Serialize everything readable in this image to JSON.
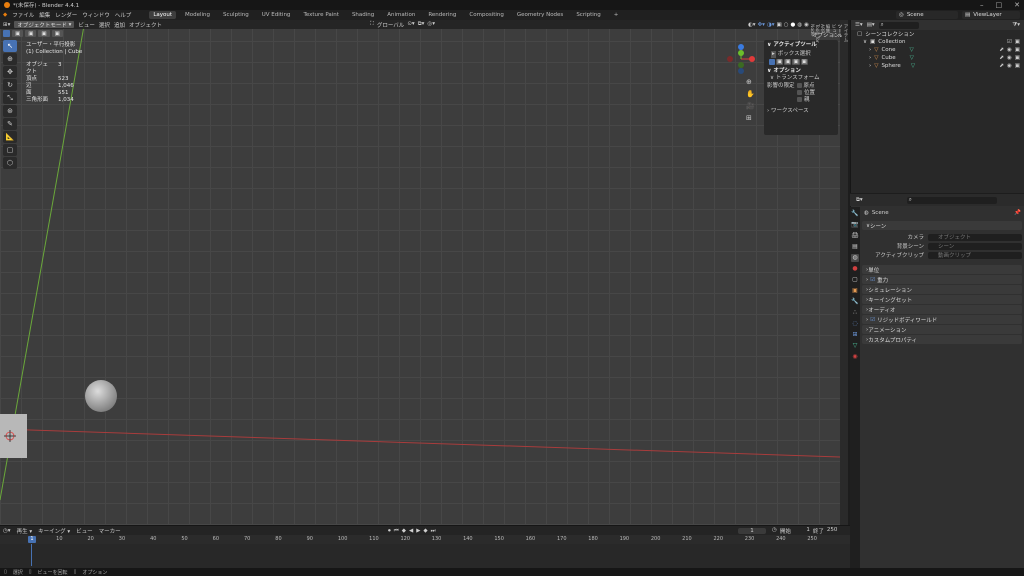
{
  "title_bar": {
    "title": "*(未保存) - Blender 4.4.1"
  },
  "menu": [
    "ファイル",
    "編集",
    "レンダー",
    "ウィンドウ",
    "ヘルプ"
  ],
  "workspaces": [
    "Layout",
    "Modeling",
    "Sculpting",
    "UV Editing",
    "Texture Paint",
    "Shading",
    "Animation",
    "Rendering",
    "Compositing",
    "Geometry Nodes",
    "Scripting"
  ],
  "workspace_add": "+",
  "scene": {
    "name": "Scene",
    "view_layer": "ViewLayer"
  },
  "viewport_header": {
    "mode": "オブジェクトモード",
    "menus": [
      "ビュー",
      "選択",
      "追加",
      "オブジェクト"
    ],
    "orientation": "グローバル",
    "options": "オプション"
  },
  "stats": {
    "view": "ユーザー・平行投影",
    "context": "(1) Collection | Cube",
    "rows": [
      {
        "k": "オブジェクト",
        "v": "3"
      },
      {
        "k": "頂点",
        "v": "523"
      },
      {
        "k": "辺",
        "v": "1,046"
      },
      {
        "k": "面",
        "v": "551"
      },
      {
        "k": "三角形面",
        "v": "1,034"
      }
    ]
  },
  "npanel": {
    "active_tool": "アクティブツール",
    "box_select": "ボックス選択",
    "options": "オプション",
    "transform": "トランスフォーム",
    "affect_only": "影響の限定",
    "origins": "原点",
    "locations": "位置",
    "parents": "親",
    "workspace": "ワークスペース"
  },
  "side_tabs": [
    "アイテム",
    "ツール",
    "ビュー",
    "編集",
    "ARP",
    "Tools for ...",
    "Node"
  ],
  "outliner": {
    "root": "シーンコレクション",
    "collection": "Collection",
    "items": [
      "Cone",
      "Cube",
      "Sphere"
    ]
  },
  "properties": {
    "scene_name": "Scene",
    "section": "シーン",
    "camera_label": "カメラ",
    "camera_placeholder": "オブジェクト",
    "bg_label": "背景シーン",
    "bg_placeholder": "シーン",
    "clip_label": "アクティブクリップ",
    "clip_placeholder": "動画クリップ",
    "panels": [
      "単位",
      "重力",
      "シミュレーション",
      "キーイングセット",
      "オーディオ",
      "リジッドボディワールド",
      "アニメーション",
      "カスタムプロパティ"
    ]
  },
  "timeline": {
    "menus": [
      "再生",
      "キーイング",
      "ビュー",
      "マーカー"
    ],
    "current": "1",
    "start_label": "開始",
    "start": "1",
    "end_label": "終了",
    "end": "250",
    "ticks": [
      "1",
      "10",
      "20",
      "30",
      "40",
      "50",
      "60",
      "70",
      "80",
      "90",
      "100",
      "110",
      "120",
      "130",
      "140",
      "150",
      "160",
      "170",
      "180",
      "190",
      "200",
      "210",
      "220",
      "230",
      "240",
      "250"
    ]
  },
  "statusbar": [
    "選択",
    "ビューを回転",
    "オプション"
  ],
  "colors": {
    "accent": "#4772b3",
    "x_axis": "#a83c3c",
    "y_axis": "#6aa83a",
    "gizmo_x": "#e03a3a",
    "gizmo_y": "#6bbf2b",
    "gizmo_z": "#3a7be0"
  }
}
